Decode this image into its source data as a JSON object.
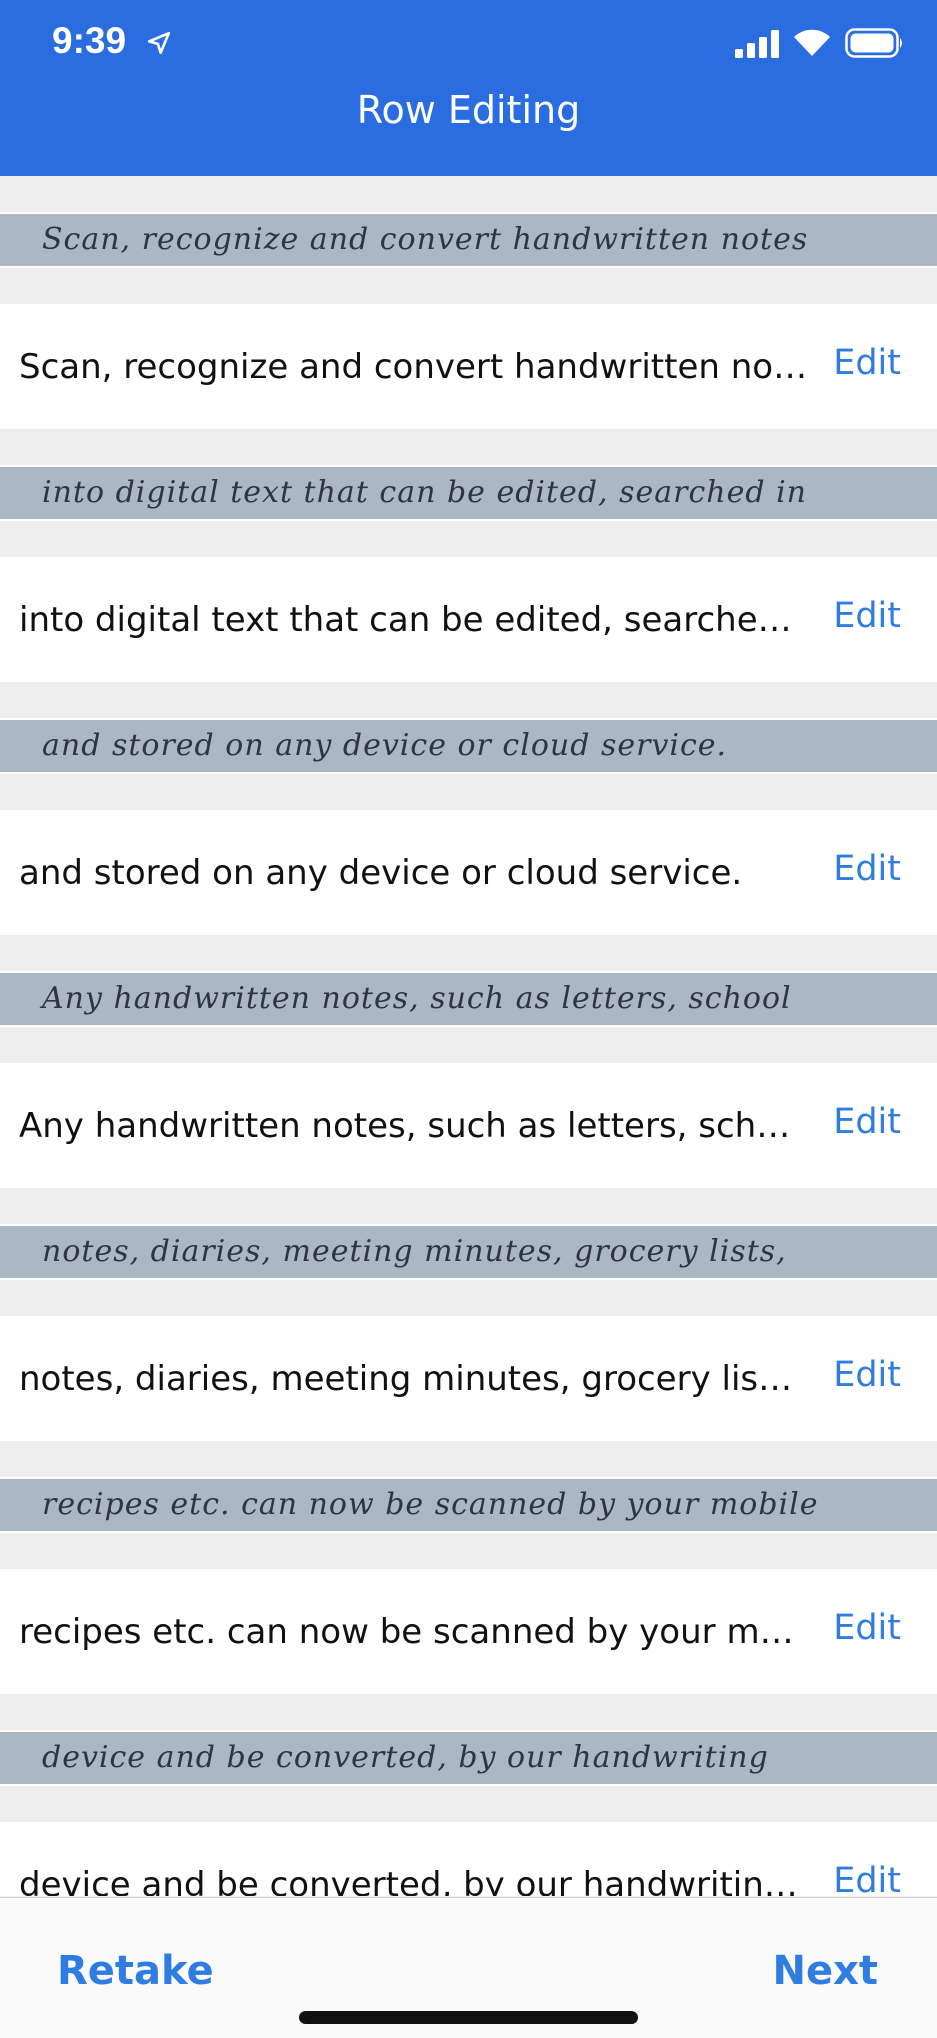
{
  "status_bar": {
    "time": "9:39"
  },
  "nav": {
    "title": "Row Editing"
  },
  "rows": [
    {
      "scan_text": "Scan, recognize and convert handwritten notes",
      "text": "Scan, recognize and convert handwritten no…",
      "edit_label": "Edit"
    },
    {
      "scan_text": "into digital text that can be edited, searched in",
      "text": "into digital text that can be edited, searche…",
      "edit_label": "Edit"
    },
    {
      "scan_text": "and stored on any device or cloud service.",
      "text": "and stored on any device or cloud service.",
      "edit_label": "Edit"
    },
    {
      "scan_text": "Any handwritten notes, such as letters, school",
      "text": "Any handwritten notes, such as letters, sch…",
      "edit_label": "Edit"
    },
    {
      "scan_text": "notes, diaries, meeting minutes, grocery lists,",
      "text": "notes, diaries, meeting minutes, grocery lis…",
      "edit_label": "Edit"
    },
    {
      "scan_text": "recipes etc. can now be scanned by your mobile",
      "text": "recipes etc. can now be scanned by your m…",
      "edit_label": "Edit"
    },
    {
      "scan_text": "device and be converted, by our handwriting",
      "text": "device and be converted, by our handwriting…",
      "edit_label": "Edit"
    }
  ],
  "toolbar": {
    "retake_label": "Retake",
    "next_label": "Next"
  },
  "colors": {
    "header": "#2a6de0",
    "accent": "#2f7de1",
    "background": "#eeeeee"
  },
  "icons": [
    "location-arrow-icon",
    "signal-icon",
    "wifi-icon",
    "battery-icon"
  ]
}
